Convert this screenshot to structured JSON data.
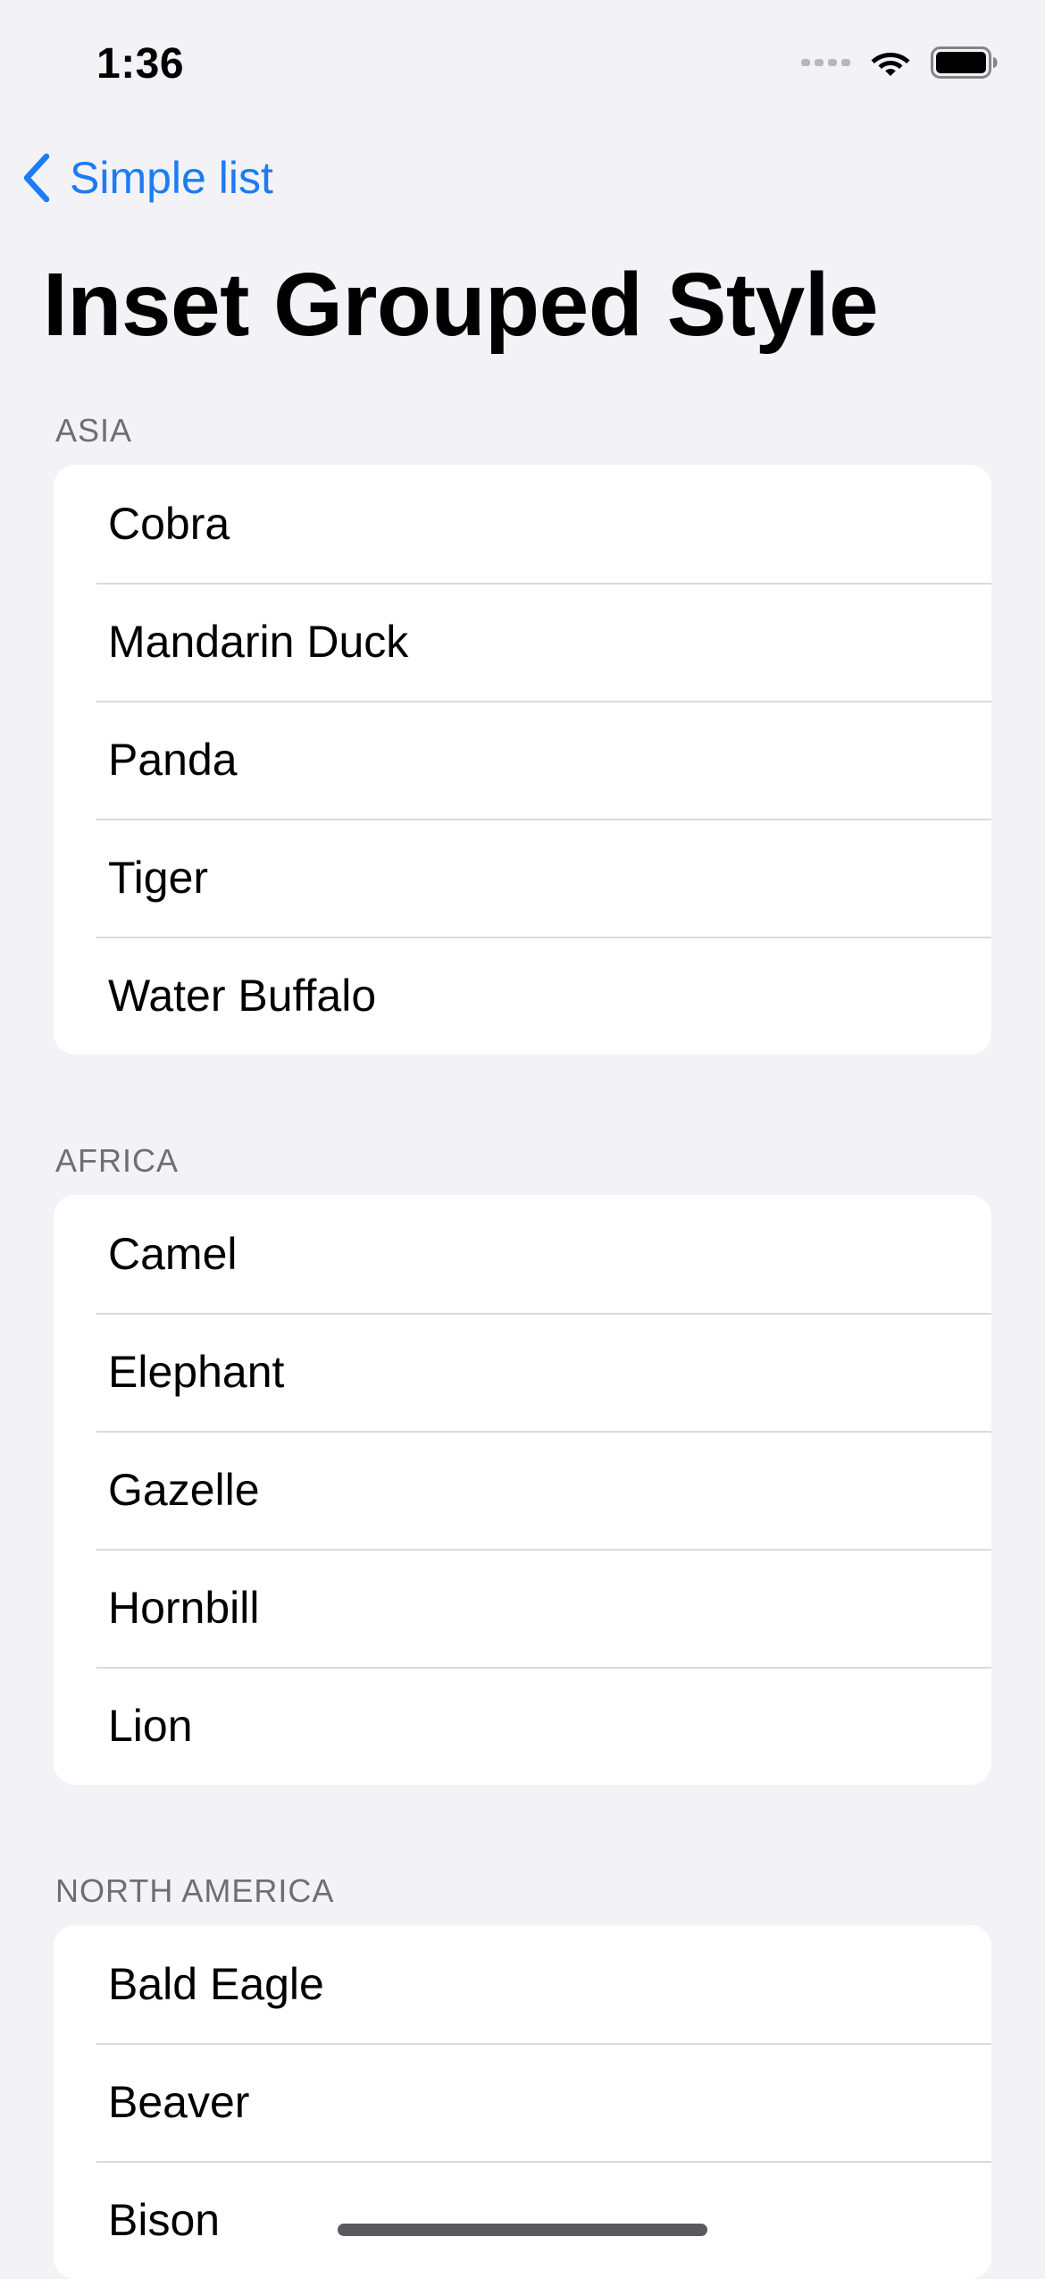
{
  "status_bar": {
    "time": "1:36",
    "icons": [
      "signal-dots-icon",
      "wifi-icon",
      "battery-icon"
    ]
  },
  "nav": {
    "back_label": "Simple list",
    "back_icon": "chevron-left-icon"
  },
  "title": "Inset Grouped Style",
  "colors": {
    "background": "#F2F2F7",
    "accent": "#1C7CF2",
    "section_header": "#6E6E73",
    "card": "#FFFFFF",
    "separator": "#DADADE"
  },
  "sections": [
    {
      "header": "ASIA",
      "items": [
        "Cobra",
        "Mandarin Duck",
        "Panda",
        "Tiger",
        "Water Buffalo"
      ]
    },
    {
      "header": "AFRICA",
      "items": [
        "Camel",
        "Elephant",
        "Gazelle",
        "Hornbill",
        "Lion"
      ]
    },
    {
      "header": "NORTH AMERICA",
      "items": [
        "Bald Eagle",
        "Beaver",
        "Bison"
      ]
    }
  ]
}
